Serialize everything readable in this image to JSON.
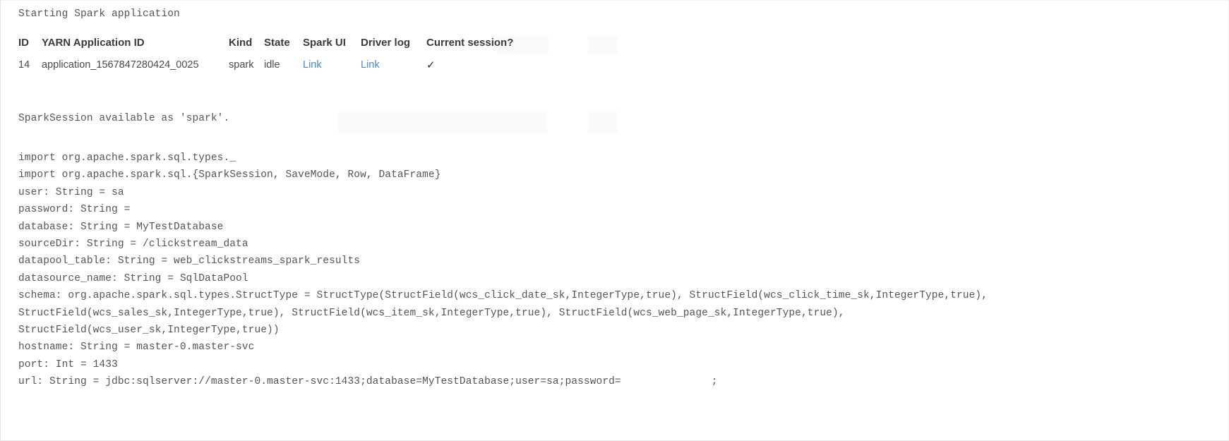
{
  "console": {
    "starting_message": "Starting Spark application"
  },
  "app_table": {
    "headers": [
      "ID",
      "YARN Application ID",
      "Kind",
      "State",
      "Spark UI",
      "Driver log",
      "Current session?"
    ],
    "rows": [
      {
        "id": "14",
        "yarn_application_id": "application_1567847280424_0025",
        "kind": "spark",
        "state": "idle",
        "spark_ui": "Link",
        "driver_log": "Link",
        "current_session": "✓"
      }
    ],
    "link_color": "#4a89c6",
    "header_color": "#3b3b3b"
  },
  "session": {
    "available_message": "SparkSession available as 'spark'."
  },
  "code_output": {
    "lines": [
      "import org.apache.spark.sql.types._",
      "import org.apache.spark.sql.{SparkSession, SaveMode, Row, DataFrame}",
      "user: String = sa",
      "password: String =",
      "database: String = MyTestDatabase",
      "sourceDir: String = /clickstream_data",
      "datapool_table: String = web_clickstreams_spark_results",
      "datasource_name: String = SqlDataPool",
      "schema: org.apache.spark.sql.types.StructType = StructType(StructField(wcs_click_date_sk,IntegerType,true), StructField(wcs_click_time_sk,IntegerType,true),",
      "StructField(wcs_sales_sk,IntegerType,true), StructField(wcs_item_sk,IntegerType,true), StructField(wcs_web_page_sk,IntegerType,true),",
      "StructField(wcs_user_sk,IntegerType,true))",
      "hostname: String = master-0.master-svc",
      "port: Int = 1433"
    ],
    "url_line": {
      "prefix": "url: String = jdbc:sqlserver://master-0.master-svc:1433;database=MyTestDatabase;user=sa;password=",
      "redacted_value": "",
      "suffix": ";"
    },
    "text_color": "#555555"
  }
}
